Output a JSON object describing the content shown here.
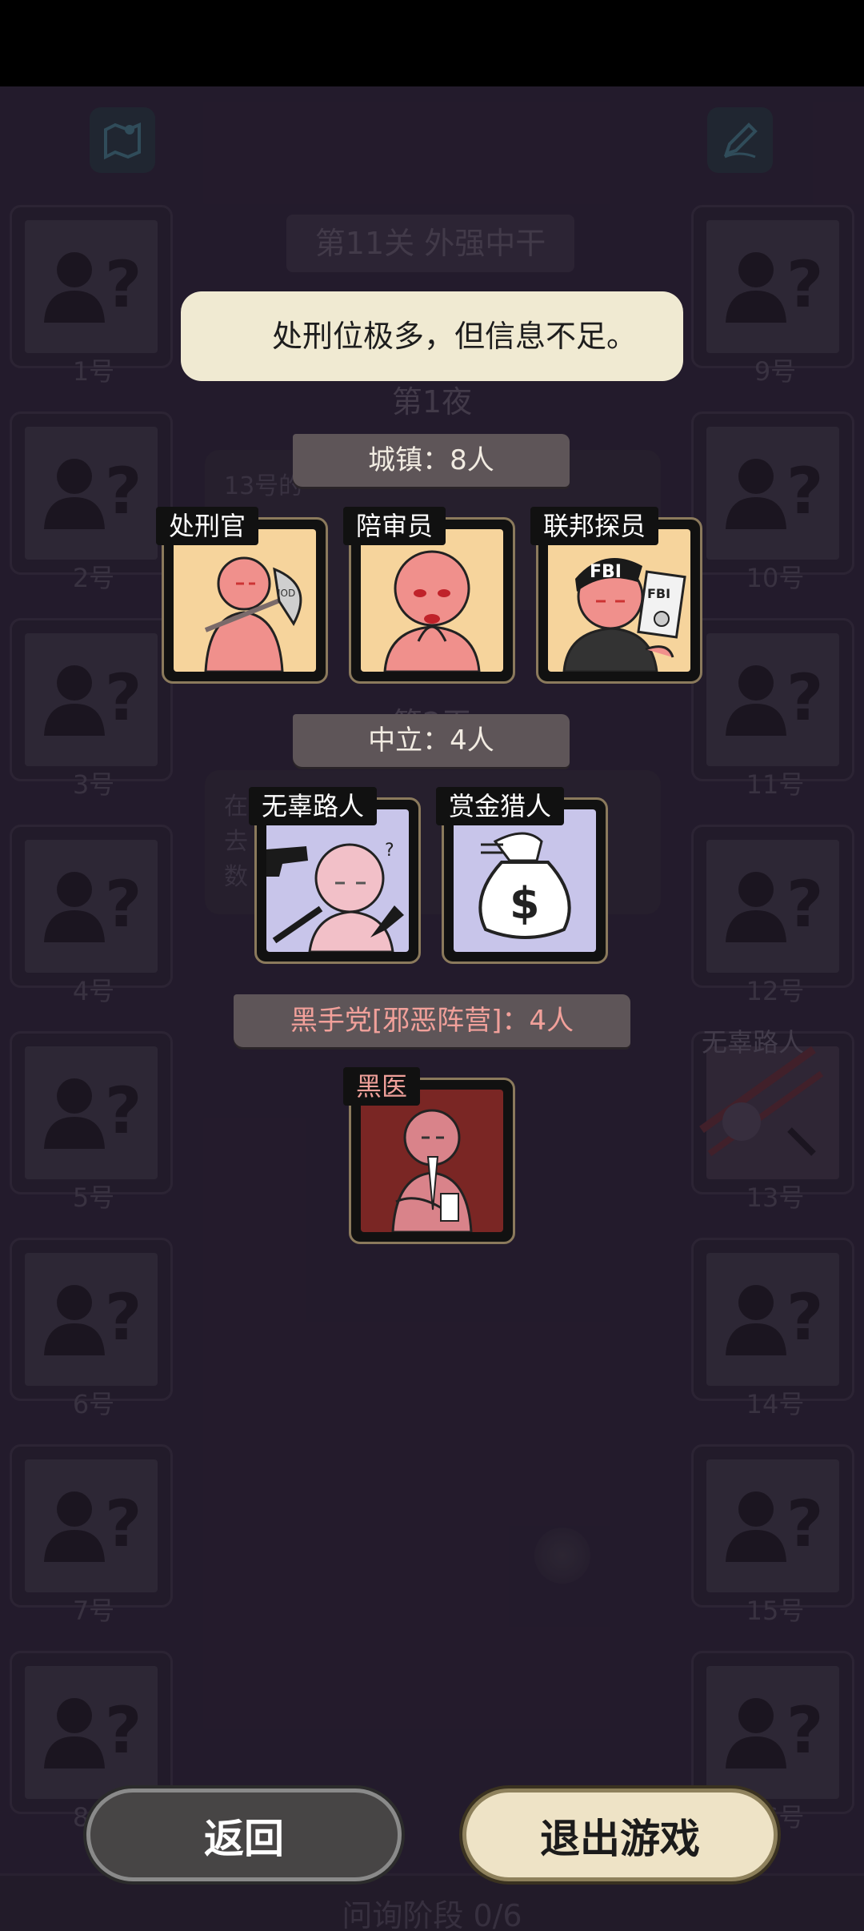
{
  "background": {
    "level_title": "第11关 外强中干",
    "night_label": "第1夜",
    "day_label": "第2天",
    "ghost_text_1": "13号的",
    "ghost_text_2": "在",
    "ghost_text_3": "去",
    "ghost_text_4": "数",
    "left_slots": [
      "1号",
      "2号",
      "3号",
      "4号",
      "5号",
      "6号",
      "7号",
      "8号"
    ],
    "right_slots": [
      "9号",
      "10号",
      "11号",
      "12号",
      "13号",
      "14号",
      "15号",
      "16号"
    ],
    "slot13_role": "无辜路人",
    "phase_label": "问询阶段 0/6"
  },
  "hint": {
    "text": "处刑位极多，但信息不足。"
  },
  "sections": {
    "town": {
      "label": "城镇：8人",
      "roles": [
        "处刑官",
        "陪审员",
        "联邦探员"
      ]
    },
    "neutral": {
      "label": "中立：4人",
      "roles": [
        "无辜路人",
        "赏金猎人"
      ]
    },
    "evil": {
      "label": "黑手党[邪恶阵营]：4人",
      "roles": [
        "黑医"
      ]
    }
  },
  "card_text": {
    "axe_label": "IOD",
    "fbi_cap": "FBI",
    "fbi_badge": "FBI",
    "money_sign": "$",
    "question": "?"
  },
  "buttons": {
    "back": "返回",
    "exit": "退出游戏"
  },
  "colors": {
    "town_card_bg": "#f6d49c",
    "neutral_card_bg": "#c8c5ea",
    "evil_card_bg": "#7a2624",
    "evil_text": "#f1a09a"
  }
}
